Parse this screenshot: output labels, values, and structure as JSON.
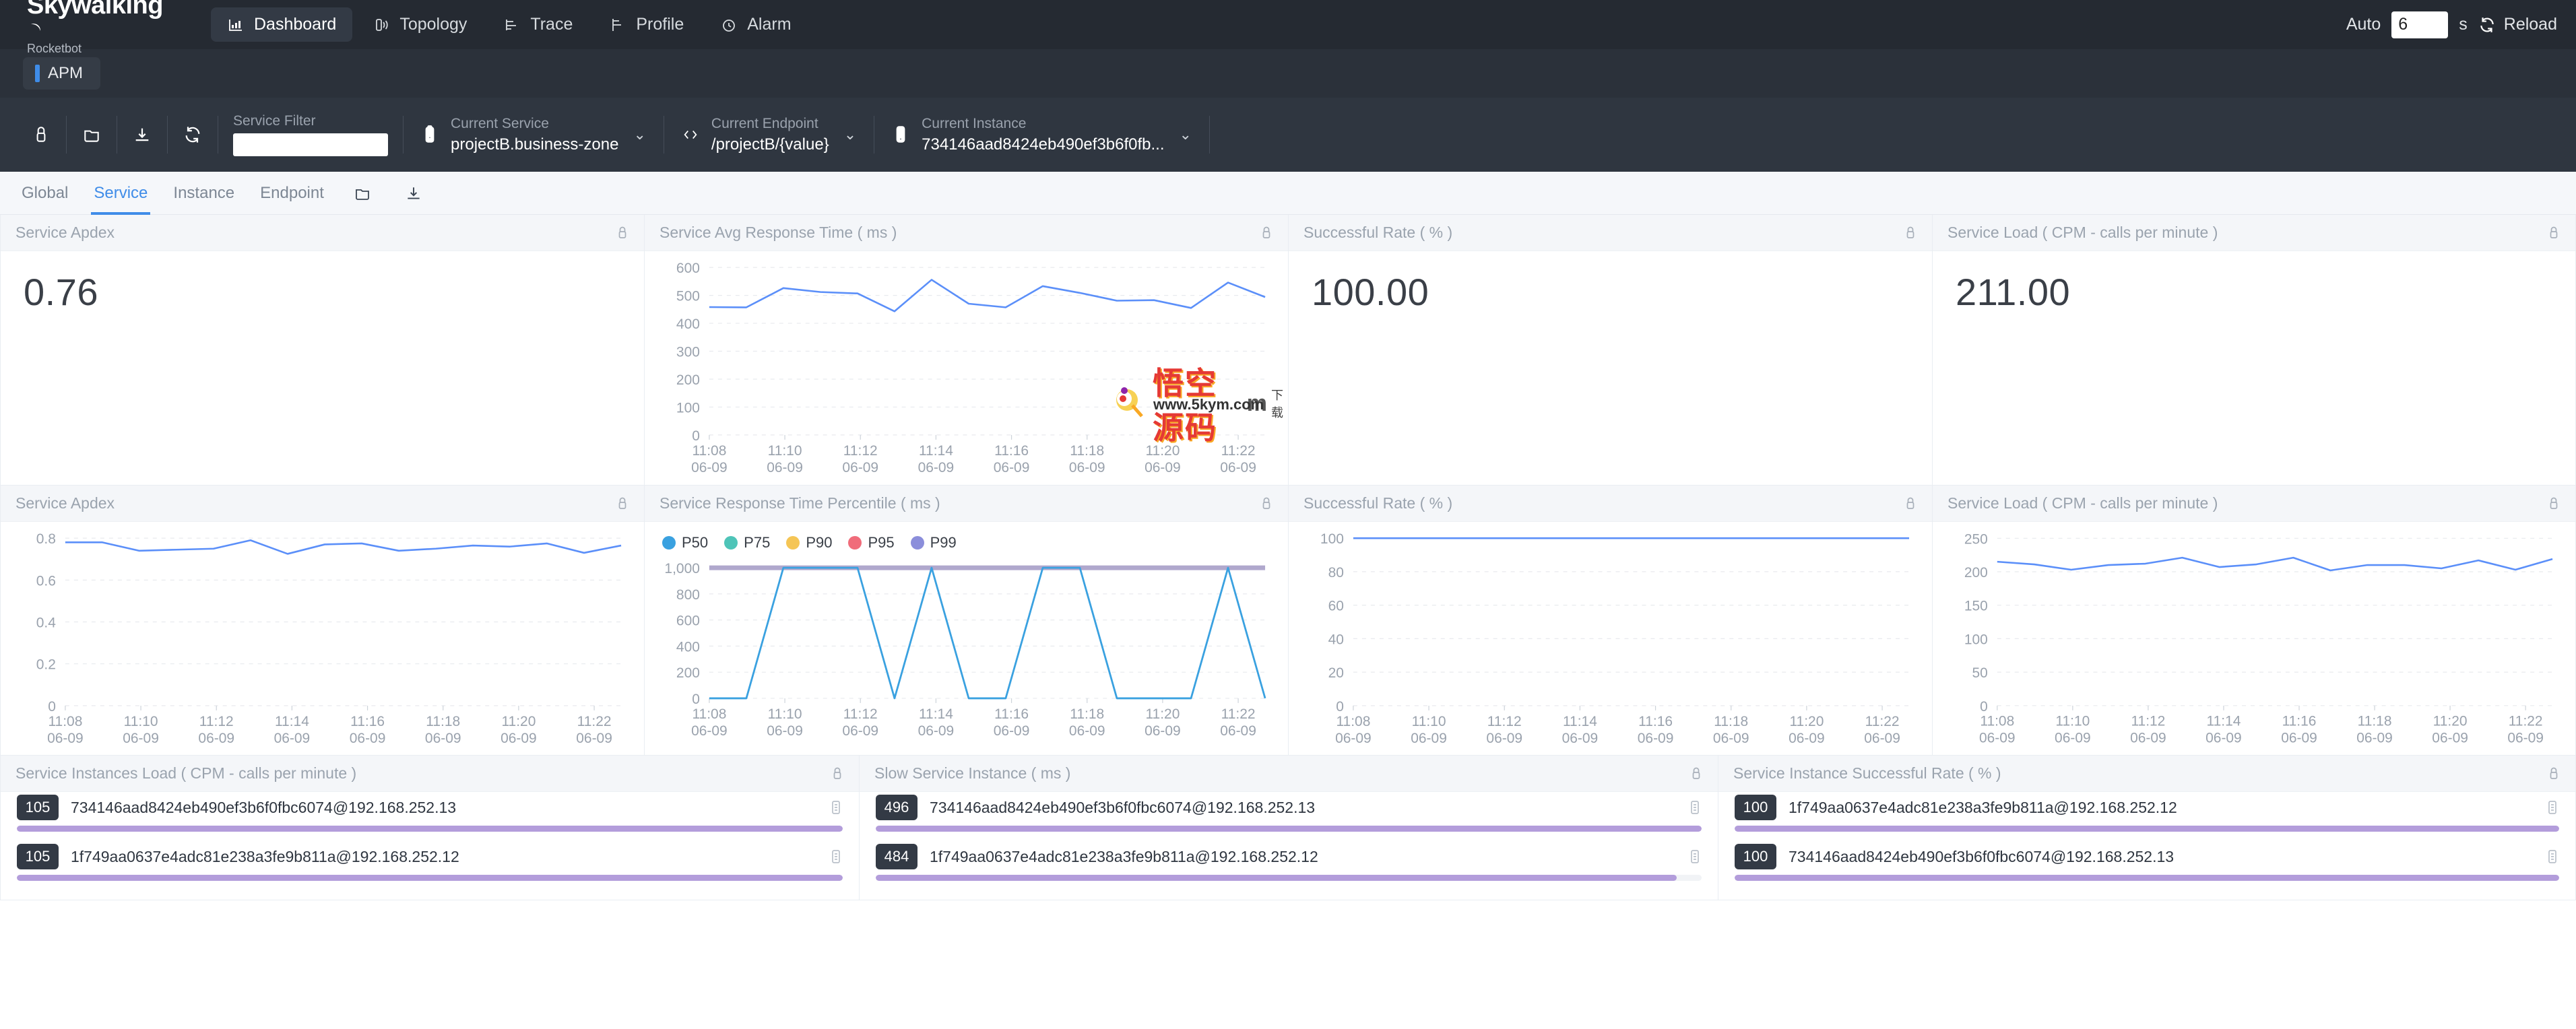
{
  "header": {
    "logo_main": "Skywalking",
    "logo_sub": "Rocketbot",
    "nav": [
      {
        "label": "Dashboard",
        "icon": "chart-bar-icon",
        "active": true
      },
      {
        "label": "Topology",
        "icon": "topology-icon",
        "active": false
      },
      {
        "label": "Trace",
        "icon": "trace-icon",
        "active": false
      },
      {
        "label": "Profile",
        "icon": "profile-icon",
        "active": false
      },
      {
        "label": "Alarm",
        "icon": "alarm-clock-icon",
        "active": false
      }
    ],
    "auto_label": "Auto",
    "auto_value": "6",
    "auto_unit": "s",
    "reload_label": "Reload",
    "reload_icon": "refresh-icon"
  },
  "apm_tab": {
    "label": "APM",
    "accent": "#3f8ce8"
  },
  "toolbar": {
    "icons": [
      "lock-icon",
      "folder-icon",
      "download-icon",
      "refresh-icon"
    ],
    "service_filter": {
      "label": "Service Filter",
      "value": "",
      "placeholder": ""
    },
    "current_service": {
      "label": "Current Service",
      "value": "projectB.business-zone",
      "icon": "server-icon"
    },
    "current_endpoint": {
      "label": "Current Endpoint",
      "value": "/projectB/{value}",
      "icon": "code-brackets-icon"
    },
    "current_instance": {
      "label": "Current Instance",
      "value": "734146aad8424eb490ef3b6f0fb...",
      "icon": "mobile-icon"
    }
  },
  "subtabs": {
    "items": [
      {
        "label": "Global",
        "active": false
      },
      {
        "label": "Service",
        "active": true
      },
      {
        "label": "Instance",
        "active": false
      },
      {
        "label": "Endpoint",
        "active": false
      }
    ],
    "icons": [
      "folder-icon",
      "download-icon"
    ]
  },
  "cards": {
    "service_apdex_value": {
      "title": "Service Apdex",
      "value": "0.76",
      "lock_icon": "lock-icon"
    },
    "avg_response_time": {
      "title": "Service Avg Response Time ( ms )",
      "lock_icon": "lock-icon"
    },
    "successful_rate_value": {
      "title": "Successful Rate ( % )",
      "value": "100.00",
      "lock_icon": "lock-icon"
    },
    "service_load_value": {
      "title": "Service Load ( CPM - calls per minute )",
      "value": "211.00",
      "lock_icon": "lock-icon"
    },
    "service_apdex_chart": {
      "title": "Service Apdex",
      "lock_icon": "lock-icon"
    },
    "response_percentile": {
      "title": "Service Response Time Percentile ( ms )",
      "lock_icon": "lock-icon"
    },
    "successful_rate_chart": {
      "title": "Successful Rate ( % )",
      "lock_icon": "lock-icon"
    },
    "service_load_chart": {
      "title": "Service Load ( CPM - calls per minute )",
      "lock_icon": "lock-icon"
    }
  },
  "bottom_panels": [
    {
      "title": "Service Instances Load ( CPM - calls per minute )",
      "lock_icon": "lock-icon",
      "items": [
        {
          "badge": "105",
          "name": "734146aad8424eb490ef3b6f0fbc6074@192.168.252.13",
          "bar_pct": 100,
          "copy_icon": "copy-icon"
        },
        {
          "badge": "105",
          "name": "1f749aa0637e4adc81e238a3fe9b811a@192.168.252.12",
          "bar_pct": 100,
          "copy_icon": "copy-icon"
        }
      ]
    },
    {
      "title": "Slow Service Instance ( ms )",
      "lock_icon": "lock-icon",
      "items": [
        {
          "badge": "496",
          "name": "734146aad8424eb490ef3b6f0fbc6074@192.168.252.13",
          "bar_pct": 100,
          "copy_icon": "copy-icon"
        },
        {
          "badge": "484",
          "name": "1f749aa0637e4adc81e238a3fe9b811a@192.168.252.12",
          "bar_pct": 97,
          "copy_icon": "copy-icon"
        }
      ]
    },
    {
      "title": "Service Instance Successful Rate ( % )",
      "lock_icon": "lock-icon",
      "items": [
        {
          "badge": "100",
          "name": "1f749aa0637e4adc81e238a3fe9b811a@192.168.252.12",
          "bar_pct": 100,
          "copy_icon": "copy-icon"
        },
        {
          "badge": "100",
          "name": "734146aad8424eb490ef3b6f0fbc6074@192.168.252.13",
          "bar_pct": 100,
          "copy_icon": "copy-icon"
        }
      ]
    }
  ],
  "watermark": {
    "chars": "悟空源码",
    "url": "www.5kym.com",
    "m": "m",
    "dl": "下载"
  },
  "chart_data": [
    {
      "id": "avg_response_time",
      "type": "line",
      "title": "Service Avg Response Time ( ms )",
      "xlabel": "",
      "ylabel": "",
      "ylim": [
        0,
        600
      ],
      "yticks": [
        0,
        100,
        200,
        300,
        400,
        500,
        600
      ],
      "xticks": [
        "11:08",
        "11:10",
        "11:12",
        "11:14",
        "11:16",
        "11:18",
        "11:20",
        "11:22"
      ],
      "xtick_sub": "06-09",
      "grid": true,
      "color": "#5b8ff9",
      "values": [
        458,
        457,
        526,
        512,
        507,
        443,
        556,
        470,
        457,
        533,
        509,
        481,
        483,
        455,
        546,
        494
      ]
    },
    {
      "id": "service_apdex_chart",
      "type": "line",
      "title": "Service Apdex",
      "ylim": [
        0,
        0.8
      ],
      "yticks": [
        0,
        0.2,
        0.4,
        0.6,
        0.8
      ],
      "xticks": [
        "11:08",
        "11:10",
        "11:12",
        "11:14",
        "11:16",
        "11:18",
        "11:20",
        "11:22"
      ],
      "xtick_sub": "06-09",
      "grid": true,
      "color": "#5b8ff9",
      "values": [
        0.78,
        0.78,
        0.74,
        0.745,
        0.75,
        0.79,
        0.725,
        0.77,
        0.775,
        0.74,
        0.75,
        0.765,
        0.76,
        0.775,
        0.73,
        0.765
      ]
    },
    {
      "id": "response_percentile",
      "type": "line",
      "title": "Service Response Time Percentile ( ms )",
      "ylim": [
        0,
        1000
      ],
      "yticks": [
        0,
        200,
        400,
        600,
        800,
        1000
      ],
      "ytick_labels": [
        "0",
        "200",
        "400",
        "600",
        "800",
        "1,000"
      ],
      "xticks": [
        "11:08",
        "11:10",
        "11:12",
        "11:14",
        "11:16",
        "11:18",
        "11:20",
        "11:22"
      ],
      "xtick_sub": "06-09",
      "grid": true,
      "legend": [
        "P50",
        "P75",
        "P90",
        "P95",
        "P99"
      ],
      "legend_colors": [
        "#3aa1e0",
        "#4ec4b8",
        "#f5c555",
        "#f06c7a",
        "#8b8edb"
      ],
      "legend_position": "top-left",
      "series": [
        {
          "name": "P50",
          "color": "#3aa1e0",
          "values": [
            0,
            0,
            1000,
            1000,
            1000,
            0,
            1000,
            0,
            0,
            1000,
            1000,
            0,
            0,
            0,
            1000,
            0
          ]
        },
        {
          "name": "P99",
          "color": "#b0a8cd",
          "values": [
            1000,
            1000,
            1000,
            1000,
            1000,
            1000,
            1000,
            1000,
            1000,
            1000,
            1000,
            1000,
            1000,
            1000,
            1000,
            1000
          ]
        }
      ]
    },
    {
      "id": "successful_rate_chart",
      "type": "line",
      "title": "Successful Rate ( % )",
      "ylim": [
        0,
        100
      ],
      "yticks": [
        0,
        20,
        40,
        60,
        80,
        100
      ],
      "xticks": [
        "11:08",
        "11:10",
        "11:12",
        "11:14",
        "11:16",
        "11:18",
        "11:20",
        "11:22"
      ],
      "xtick_sub": "06-09",
      "grid": true,
      "color": "#5b8ff9",
      "values": [
        100,
        100,
        100,
        100,
        100,
        100,
        100,
        100,
        100,
        100,
        100,
        100,
        100,
        100,
        100,
        100
      ]
    },
    {
      "id": "service_load_chart",
      "type": "line",
      "title": "Service Load ( CPM - calls per minute )",
      "ylim": [
        0,
        250
      ],
      "yticks": [
        0,
        50,
        100,
        150,
        200,
        250
      ],
      "xticks": [
        "11:08",
        "11:10",
        "11:12",
        "11:14",
        "11:16",
        "11:18",
        "11:20",
        "11:22"
      ],
      "xtick_sub": "06-09",
      "grid": true,
      "color": "#5b8ff9",
      "values": [
        215,
        211,
        203,
        210,
        212,
        221,
        207,
        211,
        221,
        202,
        210,
        210,
        205,
        217,
        203,
        219
      ]
    }
  ]
}
